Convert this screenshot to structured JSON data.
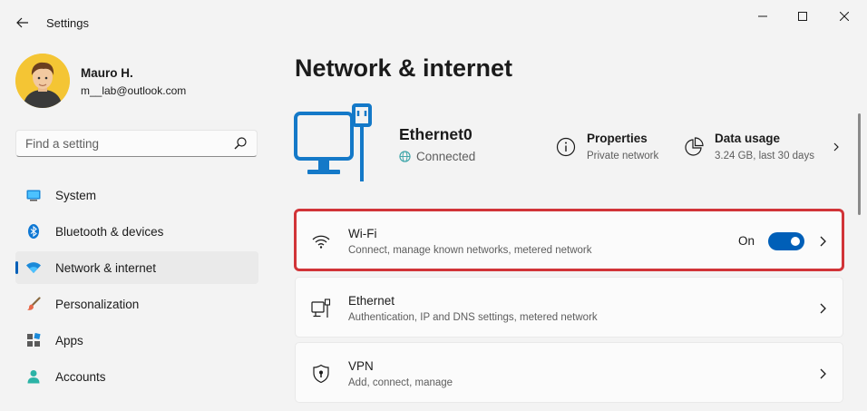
{
  "app": {
    "title": "Settings"
  },
  "user": {
    "name": "Mauro H.",
    "email": "m__lab@outlook.com"
  },
  "search": {
    "placeholder": "Find a setting"
  },
  "sidebar": {
    "items": [
      {
        "label": "System",
        "icon": "system-icon",
        "active": false
      },
      {
        "label": "Bluetooth & devices",
        "icon": "bluetooth-icon",
        "active": false
      },
      {
        "label": "Network & internet",
        "icon": "wifi-icon",
        "active": true
      },
      {
        "label": "Personalization",
        "icon": "brush-icon",
        "active": false
      },
      {
        "label": "Apps",
        "icon": "apps-icon",
        "active": false
      },
      {
        "label": "Accounts",
        "icon": "person-icon",
        "active": false
      }
    ]
  },
  "main": {
    "title": "Network & internet",
    "connection": {
      "name": "Ethernet0",
      "status": "Connected"
    },
    "properties": {
      "title": "Properties",
      "sub": "Private network"
    },
    "data_usage": {
      "title": "Data usage",
      "sub": "3.24 GB, last 30 days"
    },
    "cards": [
      {
        "title": "Wi-Fi",
        "sub": "Connect, manage known networks, metered network",
        "toggle_label": "On",
        "icon": "wifi-icon",
        "highlighted": true
      },
      {
        "title": "Ethernet",
        "sub": "Authentication, IP and DNS settings, metered network",
        "icon": "ethernet-icon"
      },
      {
        "title": "VPN",
        "sub": "Add, connect, manage",
        "icon": "shield-icon"
      }
    ]
  },
  "colors": {
    "accent": "#005fb8",
    "highlight": "#d13438",
    "background": "#f3f3f3"
  }
}
